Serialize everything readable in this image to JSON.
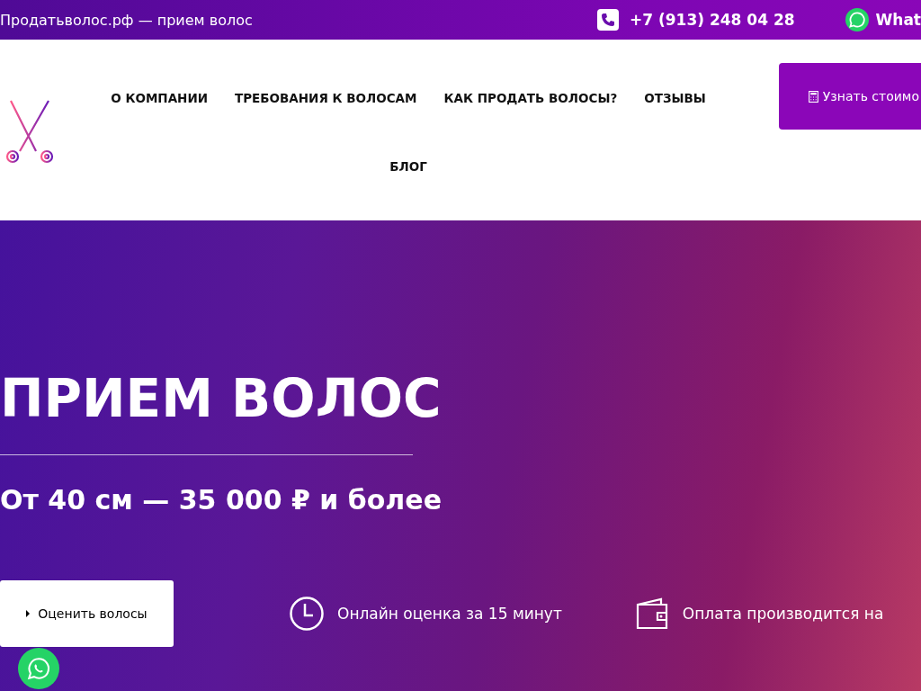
{
  "top_bar": {
    "site_title": "Продатьволос.рф — прием волос",
    "phone": "+7 (913) 248 04 28",
    "whatsapp": "What"
  },
  "nav": {
    "items": [
      {
        "label": "О КОМПАНИИ"
      },
      {
        "label": "ТРЕБОВАНИЯ К ВОЛОСАМ"
      },
      {
        "label": "КАК ПРОДАТЬ ВОЛОСЫ?"
      },
      {
        "label": "ОТЗЫВЫ"
      },
      {
        "label": "БЛОГ"
      }
    ],
    "cta": "Узнать стоимо"
  },
  "hero": {
    "title": "ПРИЕМ ВОЛОС",
    "subtitle": "От 40 см — 35 000 ₽ и более",
    "button": "Оценить волосы",
    "features": [
      {
        "kind": "clock",
        "text": "Онлайн оценка за 15 минут"
      },
      {
        "kind": "wallet",
        "text": "Оплата производится на"
      }
    ]
  }
}
